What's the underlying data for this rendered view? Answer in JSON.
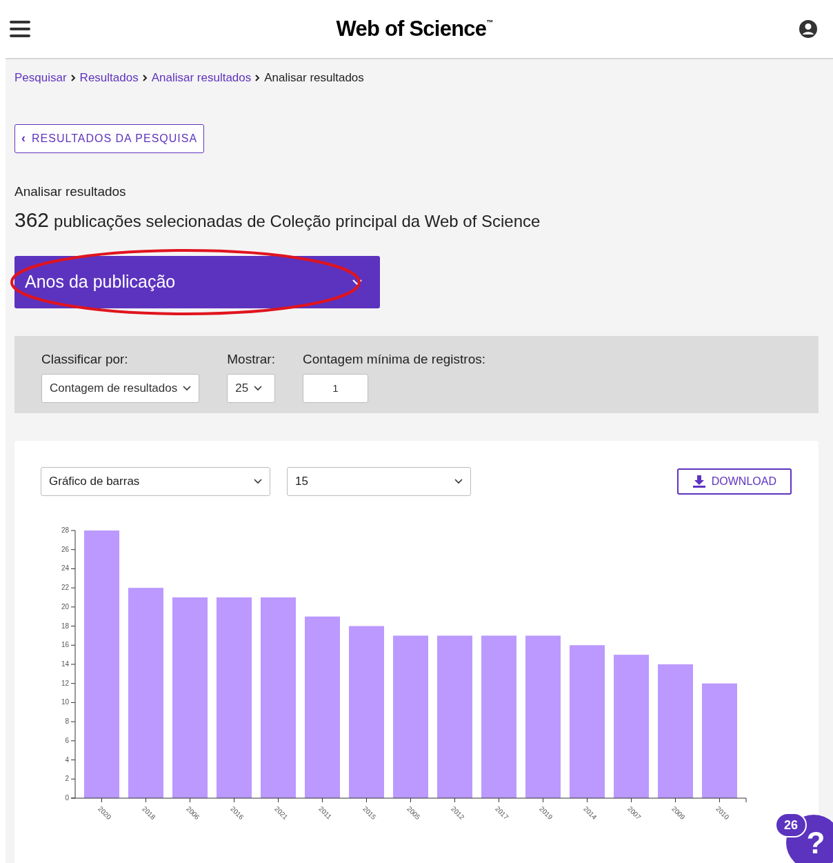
{
  "header": {
    "brand": "Web of Science",
    "trademark": "™"
  },
  "breadcrumbs": [
    {
      "label": "Pesquisar",
      "link": true
    },
    {
      "label": "Resultados",
      "link": true
    },
    {
      "label": "Analisar resultados",
      "link": true
    },
    {
      "label": "Analisar resultados",
      "link": false
    }
  ],
  "back_button": {
    "icon": "‹",
    "label": "RESULTADOS DA PESQUISA"
  },
  "section_label": "Analisar resultados",
  "summary": {
    "count": "362",
    "text": "publicações selecionadas de Coleção principal da Web of Science"
  },
  "field_selector": {
    "label": "Anos da publicação",
    "highlighted": true
  },
  "filters": [
    {
      "label": "Classificar por:",
      "kind": "dropdown",
      "value": "Contagem de resultados"
    },
    {
      "label": "Mostrar:",
      "kind": "dropdown",
      "value": "25"
    },
    {
      "label": "Contagem mínima de registros:",
      "kind": "input",
      "value": "1"
    }
  ],
  "chart_controls": {
    "chart_type": "Gráfico de barras",
    "count": "15",
    "download": "DOWNLOAD"
  },
  "chart_data": {
    "type": "bar",
    "categories": [
      "2020",
      "2018",
      "2006",
      "2016",
      "2021",
      "2011",
      "2015",
      "2005",
      "2012",
      "2017",
      "2019",
      "2014",
      "2007",
      "2009",
      "2010"
    ],
    "series": [
      {
        "color": "#bb99ff",
        "values": [
          28,
          22,
          21,
          21,
          21,
          19,
          18,
          17,
          17,
          17,
          17,
          16,
          15,
          14,
          12
        ]
      }
    ],
    "ylim": [
      0,
      28
    ],
    "yticks": [
      0,
      2,
      4,
      6,
      8,
      10,
      12,
      14,
      16,
      18,
      20,
      22,
      24,
      26,
      28
    ]
  },
  "help": {
    "badge": "26",
    "icon": "?"
  }
}
